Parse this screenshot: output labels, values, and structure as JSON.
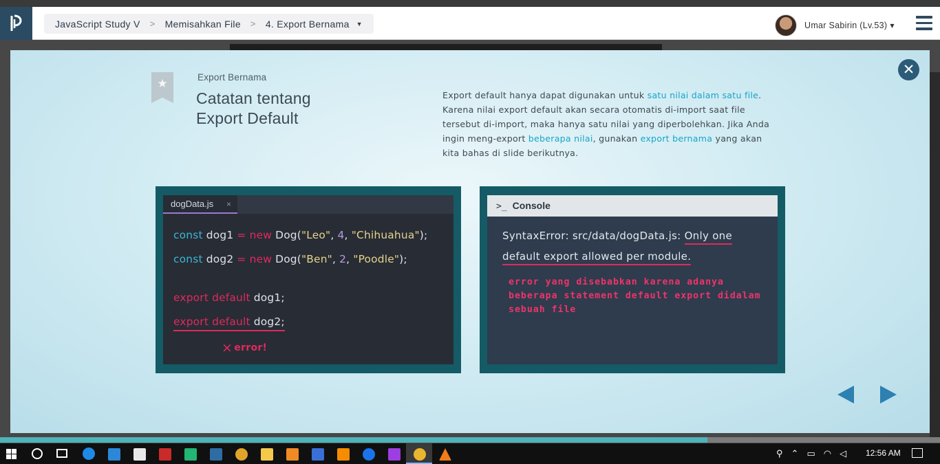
{
  "header": {
    "breadcrumb": [
      "JavaScript Study V",
      "Memisahkan File",
      "4. Export Bernama"
    ],
    "breadcrumb_separator": ">",
    "user_name": "Umar Sabirin (Lv.53)",
    "icons": [
      "logo-icon",
      "caret-down-icon",
      "avatar",
      "hamburger-menu-icon"
    ]
  },
  "slide": {
    "subtitle": "Export Bernama",
    "title_line1": "Catatan tentang",
    "title_line2": "Export Default",
    "description": {
      "p1": "Export default hanya dapat digunakan untuk ",
      "hl1": "satu nilai dalam satu file",
      "p2": ". Karena nilai export default akan secara otomatis di-import saat file tersebut di-import, maka hanya satu nilai yang diperbolehkan. Jika Anda ingin meng-export ",
      "hl2": "beberapa nilai",
      "p3": ", gunakan ",
      "hl3": "export bernama",
      "p4": " yang akan kita bahas di slide berikutnya."
    },
    "highlight_color": "#16a5c8"
  },
  "code_panel": {
    "tab_label": "dogData.js",
    "tab_close": "×",
    "line1": {
      "kw": "const",
      "name": " dog1 ",
      "eq": "=",
      "new": " new",
      "call": " Dog(",
      "s1": "\"Leo\"",
      "c1": ", ",
      "n": "4",
      "c2": ", ",
      "s2": "\"Chihuahua\"",
      "end": ");"
    },
    "line2": {
      "kw": "const",
      "name": " dog2 ",
      "eq": "=",
      "new": " new",
      "call": " Dog(",
      "s1": "\"Ben\"",
      "c1": ", ",
      "n": "2",
      "c2": ", ",
      "s2": "\"Poodle\"",
      "end": ");"
    },
    "line3": {
      "kw": "export default",
      "rest": " dog1;"
    },
    "line4": {
      "kw": "export default",
      "rest": " dog2;"
    },
    "error_icon": "×",
    "error_label": "error!"
  },
  "console_panel": {
    "title": "Console",
    "prompt": ">_",
    "msg_plain": "SyntaxError: src/data/dogData.js: ",
    "msg_u1": "Only one",
    "msg_u2": "default export allowed per module.",
    "note": "error yang disebabkan karena adanya beberapa statement default export didalam sebuah file"
  },
  "modal": {
    "close_icon": "close-icon",
    "nav": [
      "prev-arrow-icon",
      "next-arrow-icon"
    ]
  },
  "taskbar": {
    "time": "12:56 AM",
    "apps": [
      "start-icon",
      "search-icon",
      "task-view-icon",
      "edge-icon",
      "mail-icon",
      "store-icon",
      "filezilla-icon",
      "pycharm-icon",
      "powershell-icon",
      "chrome-icon",
      "explorer-icon",
      "xampp-icon",
      "sourcetree-icon",
      "sublime-icon",
      "maps-icon",
      "phpstorm-icon",
      "chrome-active-icon",
      "vlc-icon"
    ]
  }
}
